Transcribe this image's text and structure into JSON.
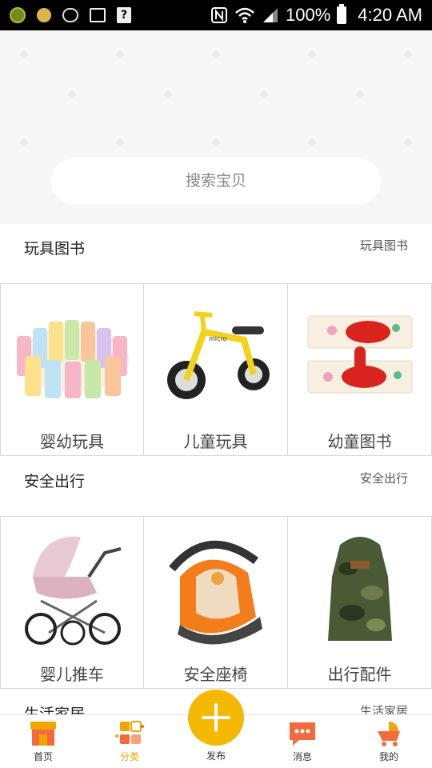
{
  "status_bar": {
    "battery": "100%",
    "time": "4:20 AM",
    "icons": [
      "app-icon-green",
      "app-icon-yellow",
      "face-icon",
      "image-icon",
      "unknown-app-icon",
      "nfc-icon",
      "wifi-icon",
      "signal-icon",
      "battery-icon"
    ]
  },
  "search": {
    "placeholder": "搜索宝贝"
  },
  "sections": [
    {
      "title": "玩具图书",
      "more": "玩具图书",
      "items": [
        {
          "label": "婴幼玩具",
          "icon": "baby-playpen"
        },
        {
          "label": "儿童玩具",
          "icon": "balance-bike"
        },
        {
          "label": "幼童图书",
          "icon": "picture-book"
        }
      ]
    },
    {
      "title": "安全出行",
      "more": "安全出行",
      "items": [
        {
          "label": "婴儿推车",
          "icon": "baby-stroller"
        },
        {
          "label": "安全座椅",
          "icon": "car-seat"
        },
        {
          "label": "出行配件",
          "icon": "baby-carrier"
        }
      ]
    },
    {
      "title": "生活家居",
      "more": "生活家居"
    }
  ],
  "bottom_nav": {
    "items": [
      {
        "label": "首页",
        "icon": "home-shop-icon"
      },
      {
        "label": "分类",
        "icon": "category-icon",
        "active": true
      },
      {
        "label": "发布",
        "icon": "plus-icon"
      },
      {
        "label": "消息",
        "icon": "message-icon"
      },
      {
        "label": "我的",
        "icon": "cart-profile-icon"
      }
    ],
    "active_color": "#f0a500"
  },
  "colors": {
    "accent": "#f5b800"
  }
}
